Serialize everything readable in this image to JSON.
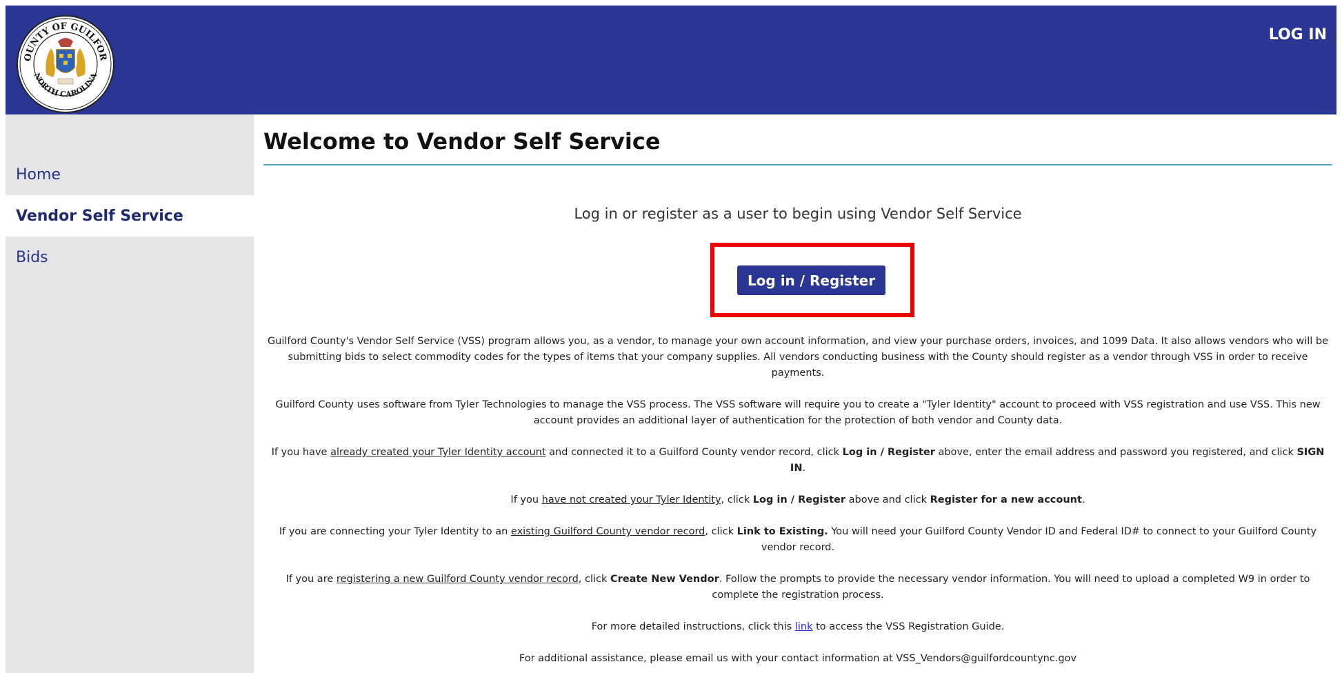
{
  "header": {
    "login_label": "LOG IN",
    "seal_text_top": "COUNTY OF GUILFORD",
    "seal_text_bottom": "NORTH CAROLINA",
    "brand_color": "#2b3694"
  },
  "sidebar": {
    "items": [
      {
        "label": "Home",
        "active": false
      },
      {
        "label": "Vendor Self Service",
        "active": true
      },
      {
        "label": "Bids",
        "active": false
      }
    ]
  },
  "main": {
    "title": "Welcome to Vendor Self Service",
    "intro": "Log in or register as a user to begin using Vendor Self Service",
    "login_button": "Log in / Register",
    "highlight_color": "#ef0000",
    "p1": "Guilford County's Vendor Self Service (VSS) program allows you, as a vendor, to manage your own account information, and view your purchase orders, invoices, and 1099 Data. It also allows vendors who will be submitting bids to select commodity codes for the types of items that your company supplies. All vendors conducting business with the County should register as a vendor through VSS in order to receive payments.",
    "p2": "Guilford County uses software from Tyler Technologies to manage the VSS process. The VSS software will require you to create a \"Tyler Identity\" account to proceed with VSS registration and use VSS. This new account provides an additional layer of authentication for the protection of both vendor and County data.",
    "p3": {
      "a": "If you have ",
      "u": "already created your Tyler Identity account",
      "b": " and connected it to a Guilford County vendor record, click ",
      "bold1": "Log in / Register",
      "c": " above, enter the email address and password you registered, and click ",
      "bold2": "SIGN IN",
      "d": "."
    },
    "p4": {
      "a": "If you ",
      "u": "have not created your Tyler Identity",
      "b": ", click ",
      "bold1": "Log in / Register",
      "c": " above and click ",
      "bold2": "Register for a new account",
      "d": "."
    },
    "p5": {
      "a": "If you are connecting your Tyler Identity to an ",
      "u": "existing Guilford County vendor record",
      "b": ", click ",
      "bold1": "Link to Existing.",
      "c": " You will need your Guilford County Vendor ID and Federal ID# to connect to your Guilford County vendor record."
    },
    "p6": {
      "a": "If you are ",
      "u": "registering a new Guilford County vendor record",
      "b": ", click ",
      "bold1": "Create New Vendor",
      "c": ". Follow the prompts to provide the necessary vendor information. You will need to upload a completed W9 in order to complete the registration process."
    },
    "p7": {
      "a": "For more detailed instructions, click this ",
      "link": "link",
      "b": " to access the VSS Registration Guide."
    },
    "p8": "For additional assistance, please email us with your contact information at VSS_Vendors@guilfordcountync.gov"
  }
}
